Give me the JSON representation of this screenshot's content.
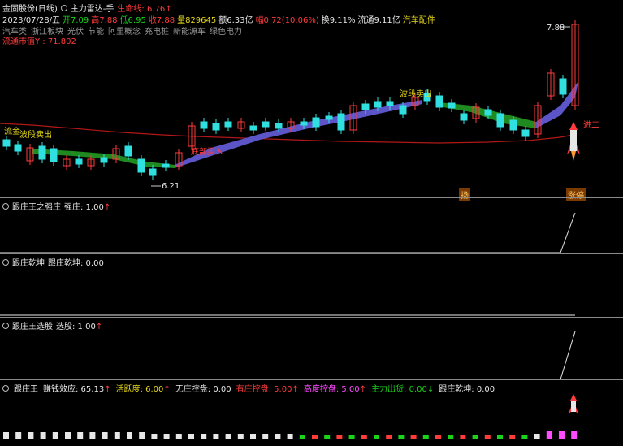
{
  "header": {
    "line1": {
      "stock_name": "金固股份(日线)",
      "indicator_name": "主力雷达-手",
      "lifeline_label": "生命线: 6.76",
      "arrow": "↑"
    },
    "line2": {
      "date": "2023/07/28/五",
      "open": "开7.09",
      "high": "高7.88",
      "low": "低6.95",
      "close": "收7.88",
      "volume": "量829645",
      "amount": "额6.33亿",
      "change": "幅0.72(10.06%)",
      "turnover": "换9.11%",
      "float": "流通9.11亿",
      "sector": "汽车配件"
    },
    "line3": {
      "concepts": [
        "汽车类",
        "浙江板块",
        "光伏",
        "节能",
        "阿里概念",
        "充电桩",
        "新能源车",
        "绿色电力"
      ]
    },
    "line4": {
      "market_cap": "流通市值Y : 71.802"
    }
  },
  "main_chart": {
    "price_max_label": "7.88",
    "price_min_label": "6.21",
    "annotations": {
      "wave_sell_1": "波段卖出",
      "wave_sell_2": "波段卖出",
      "liu_label": "流金",
      "bottom_buy": "底部买入",
      "grand_label": "进二",
      "bottom_tag_1": "扬",
      "bottom_tag_2": "涨停"
    },
    "colors": {
      "up": "#ff3b3b",
      "down": "#30e0e0",
      "band_up": "#1f8a1f",
      "band_down": "#5b55c8",
      "ma": "#b01818"
    }
  },
  "panels": {
    "p1": {
      "title": "跟庄王之强庄",
      "field": "强庄: 1.00",
      "arrow": "↑"
    },
    "p2": {
      "title": "跟庄乾坤",
      "field": "跟庄乾坤: 0.00"
    },
    "p3": {
      "title": "跟庄王选股",
      "field": "选股: 1.00",
      "arrow": "↑"
    },
    "p4": {
      "title": "跟庄王",
      "items": [
        {
          "label": "赚钱效应: 65.13",
          "arrow": "↑",
          "color": "wht"
        },
        {
          "label": "活跃度: 6.00",
          "arrow": "↑",
          "color": "yel"
        },
        {
          "label": "无庄控盘: 0.00",
          "arrow": "",
          "color": "wht"
        },
        {
          "label": "有庄控盘: 5.00",
          "arrow": "↑",
          "color": "red"
        },
        {
          "label": "高度控盘: 5.00",
          "arrow": "↑",
          "color": "mag"
        },
        {
          "label": "主力出货: 0.00",
          "arrow": "↓",
          "color": "grn"
        },
        {
          "label": "跟庄乾坤: 0.00",
          "arrow": "",
          "color": "wht"
        }
      ]
    }
  }
}
